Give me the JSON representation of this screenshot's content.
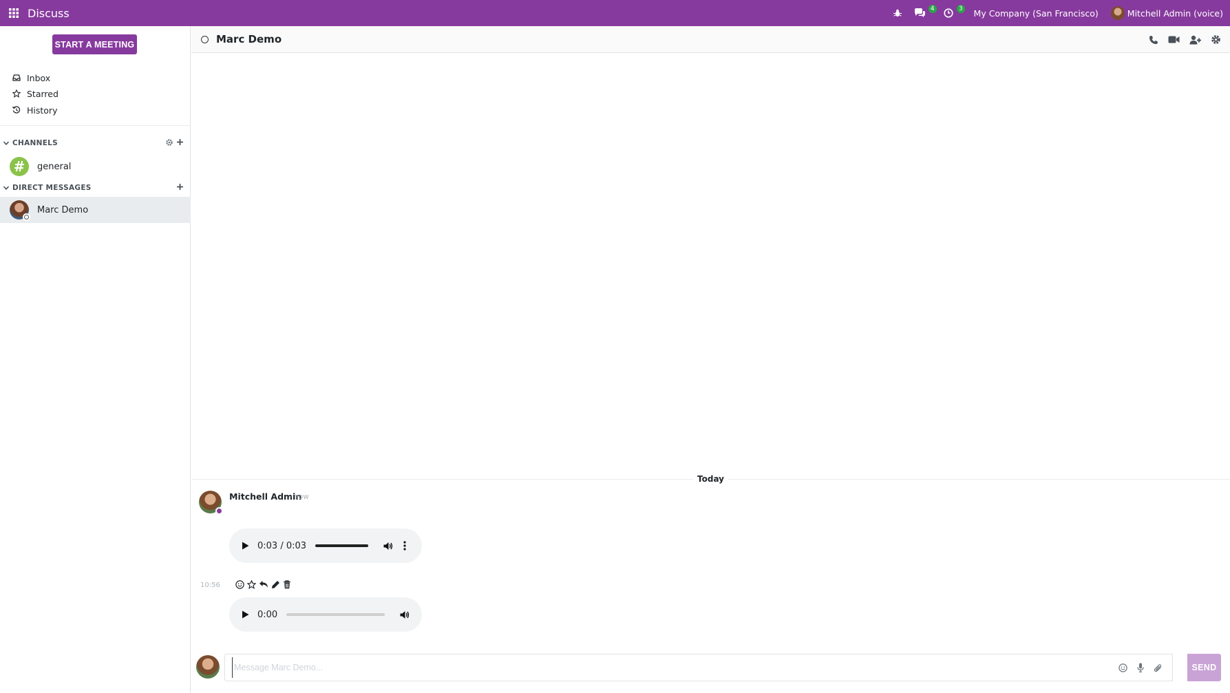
{
  "navbar": {
    "app_title": "Discuss",
    "messages_badge": "4",
    "activities_badge": "3",
    "company": "My Company (San Francisco)",
    "user": "Mitchell Admin (voice)",
    "accent_color": "#873A9E"
  },
  "sidebar": {
    "start_meeting_label": "START A MEETING",
    "mailboxes": [
      {
        "label": "Inbox",
        "icon": "inbox-icon"
      },
      {
        "label": "Starred",
        "icon": "star-icon"
      },
      {
        "label": "History",
        "icon": "history-icon"
      }
    ],
    "channels_header": "CHANNELS",
    "channels": [
      {
        "label": "general",
        "icon": "hash-icon"
      }
    ],
    "dm_header": "DIRECT MESSAGES",
    "direct_messages": [
      {
        "label": "Marc Demo",
        "active": true
      }
    ]
  },
  "thread": {
    "title": "Marc Demo",
    "actions": [
      "phone-icon",
      "video-icon",
      "add-user-icon",
      "gear-icon"
    ]
  },
  "messages": {
    "date_separator": "Today",
    "author": "Mitchell Admin",
    "date": "- now",
    "audio1": {
      "time": "0:03 / 0:03",
      "progress": 1.0
    },
    "second_time": "10:56",
    "audio2": {
      "time": "0:00",
      "progress": 0.0
    },
    "toolbar": [
      "emoji-icon",
      "star-icon",
      "reply-icon",
      "edit-icon",
      "trash-icon"
    ]
  },
  "composer": {
    "placeholder": "Message Marc Demo...",
    "send_label": "SEND",
    "tools": [
      "emoji-icon",
      "microphone-icon",
      "paperclip-icon"
    ]
  }
}
